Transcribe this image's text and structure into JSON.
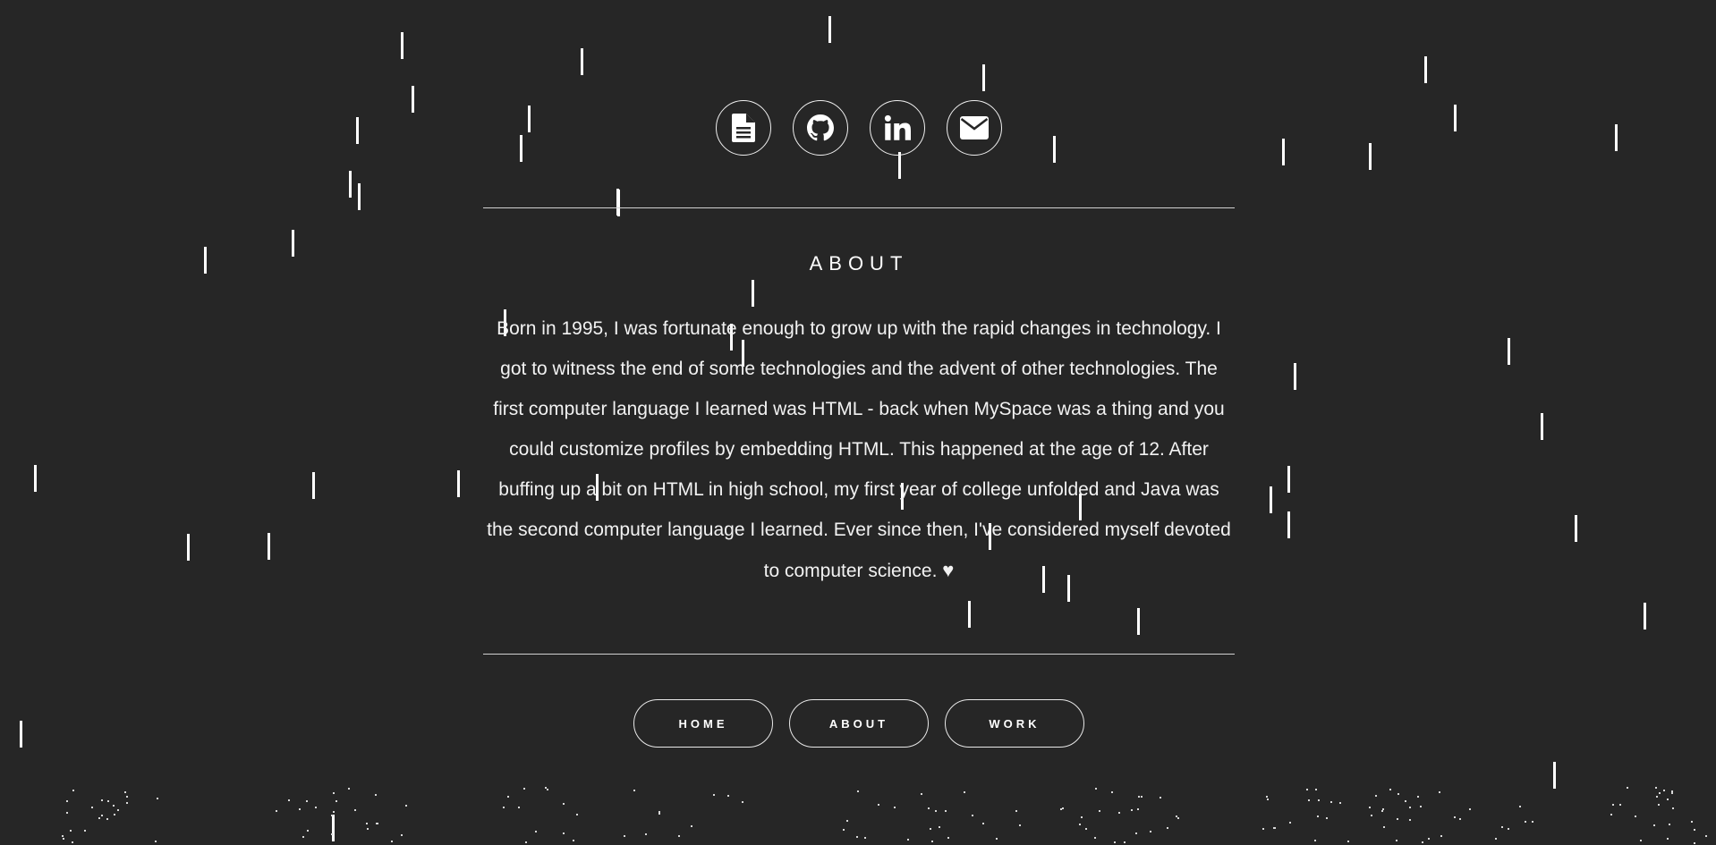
{
  "social": {
    "resume": {
      "icon": "document-icon"
    },
    "github": {
      "icon": "github-icon"
    },
    "linkedin": {
      "icon": "linkedin-icon"
    },
    "email": {
      "icon": "envelope-icon"
    }
  },
  "about": {
    "title": "ABOUT",
    "body": "Born in 1995, I was fortunate enough to grow up with the rapid changes in technology. I got to witness the end of some technologies and the advent of other technologies. The first computer language I learned was HTML - back when MySpace was a thing and you could customize profiles by embedding HTML. This happened at the age of 12. After buffing up a bit on HTML in high school, my first year of college unfolded and Java was the second computer language I learned. Ever since then, I've considered myself devoted to computer science.",
    "heart": "♥"
  },
  "nav": {
    "home": "HOME",
    "about": "ABOUT",
    "work": "WORK"
  },
  "colors": {
    "background": "#262626",
    "foreground": "#ffffff"
  }
}
